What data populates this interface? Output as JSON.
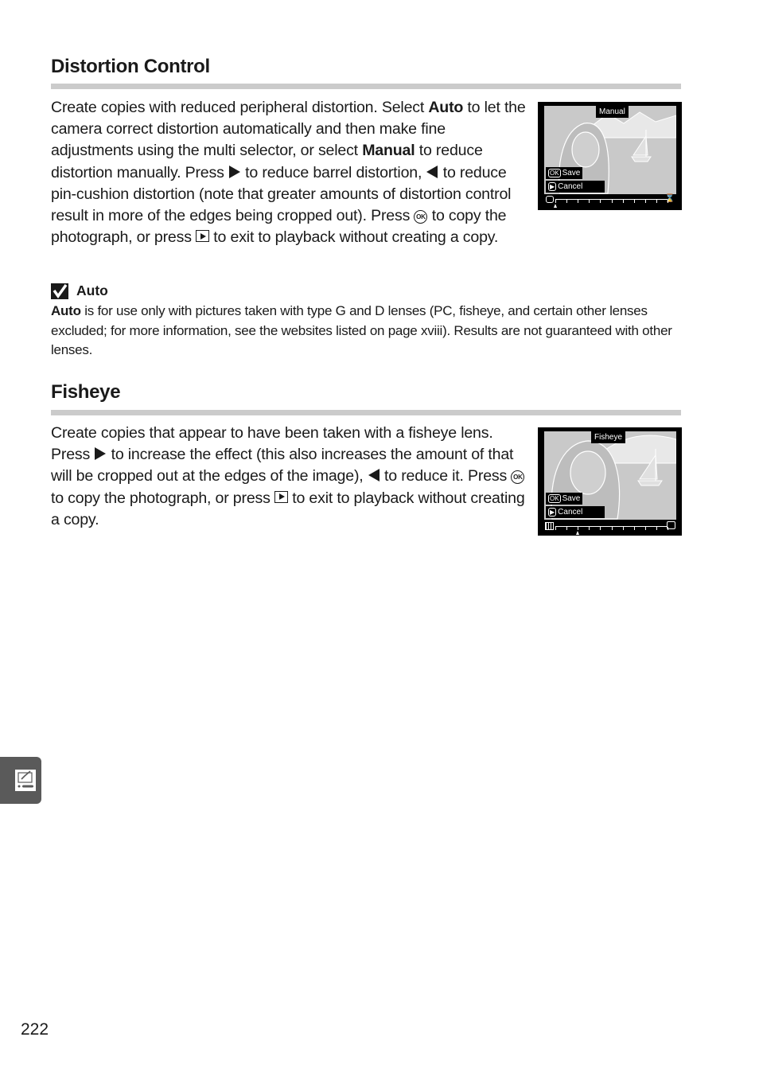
{
  "sections": [
    {
      "title": "Distortion Control",
      "paragraph": {
        "t1": "Create copies with reduced peripheral distortion.  Select ",
        "b1": "Auto",
        "t2": " to let the camera correct distortion automatically and then make fine adjustments using the multi selector, or select ",
        "b2": "Manual",
        "t3": " to reduce distortion manually.  Press ",
        "t4": " to reduce barrel distortion, ",
        "t5": " to reduce pin-cushion distortion (note that greater amounts of distortion control result in more of the edges being cropped out).  Press ",
        "t6": " to copy the photograph, or press ",
        "t7": " to exit to playback without creating a copy."
      },
      "screen": {
        "label": "Manual",
        "save_key": "OK",
        "save_label": "Save",
        "cancel_label": "Cancel",
        "slider_left_icon": "barrel-icon",
        "slider_right_icon": "pincushion-icon",
        "slider_value": 0,
        "slider_steps": 10
      }
    },
    {
      "title": "Fisheye",
      "paragraph": {
        "t1": "Create copies that appear to have been taken with a fisheye lens.  Press ",
        "t2": " to increase the effect (this also increases the amount of that will be cropped out at the edges of the image), ",
        "t3": " to reduce it.  Press ",
        "t4": " to copy the photograph, or press ",
        "t5": " to exit to playback without creating a copy."
      },
      "screen": {
        "label": "Fisheye",
        "save_key": "OK",
        "save_label": "Save",
        "cancel_label": "Cancel",
        "slider_left_icon": "grid-icon",
        "slider_right_icon": "fisheye-grid-icon",
        "slider_value": 2,
        "slider_steps": 10
      }
    }
  ],
  "note": {
    "icon": "checkmark-icon",
    "title": "Auto",
    "bold_lead": "Auto",
    "text": " is for use only with pictures taken with type G and D lenses (PC, fisheye, and certain other lenses excluded; for more information, see the websites listed on page xviii).  Results are not guaranteed with other lenses."
  },
  "glyphs": {
    "ok": "OK"
  },
  "side_tab": {
    "icon": "retouch-menu-icon"
  },
  "page_number": "222"
}
